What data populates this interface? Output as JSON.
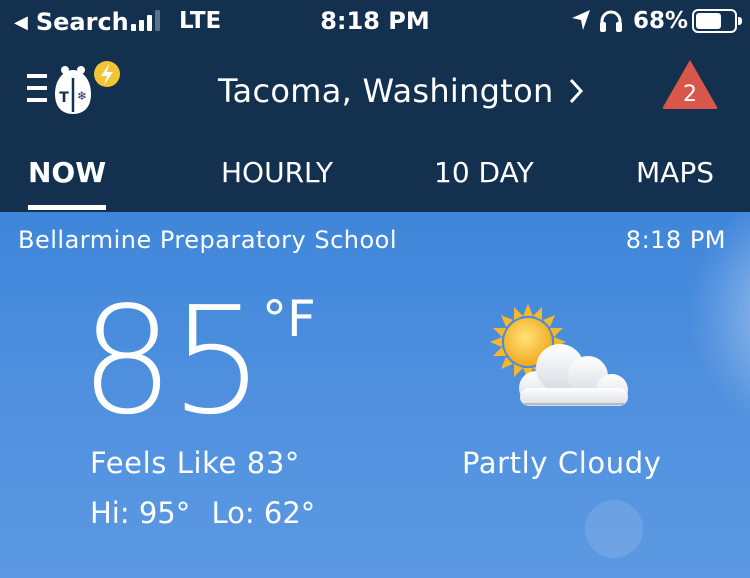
{
  "status_bar": {
    "back_label": "Search",
    "network": "LTE",
    "time": "8:18 PM",
    "battery_percent_label": "68%",
    "battery_level": 0.68,
    "signal_bars_filled": 3,
    "signal_bars_total": 4
  },
  "header": {
    "location": "Tacoma, Washington",
    "alert_count": "2",
    "alert_color": "#d9574a",
    "logo_badge_color": "#f3c534"
  },
  "tabs": [
    {
      "label": "NOW",
      "active": true
    },
    {
      "label": "HOURLY",
      "active": false
    },
    {
      "label": "10 DAY",
      "active": false
    },
    {
      "label": "MAPS",
      "active": false
    }
  ],
  "current": {
    "station": "Bellarmine Preparatory School",
    "observed_time": "8:18 PM",
    "temperature": "85",
    "unit": "°F",
    "feels_like": "Feels Like 83°",
    "hi": "Hi: 95°",
    "lo": "Lo: 62°",
    "condition": "Partly Cloudy",
    "condition_icon": "partly-cloudy-icon"
  },
  "colors": {
    "header_bg": "#13304f",
    "sky_top": "#3f86da",
    "sky_bottom": "#5c99e2"
  }
}
